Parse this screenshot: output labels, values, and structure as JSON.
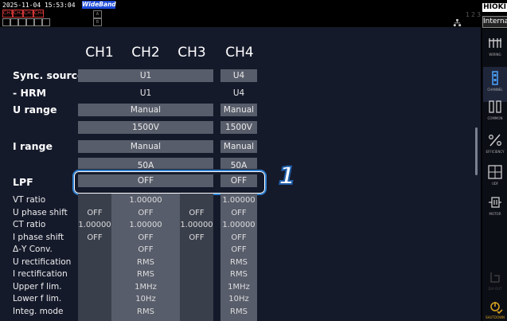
{
  "status": {
    "datetime": "2025-11-04 15:53:04",
    "bandwidth": "WideBand",
    "ch_badges": [
      "CH1",
      "CH2",
      "CH3",
      "CH4"
    ],
    "mid_badges": [
      "A",
      "B"
    ],
    "right_counters": [
      "1",
      "2",
      "3",
      "4"
    ]
  },
  "header": {
    "brand": "HIOKI",
    "mode": "Internal"
  },
  "columns": [
    "CH1",
    "CH2",
    "CH3",
    "CH4"
  ],
  "rows": {
    "sync_source": {
      "label": "Sync. source",
      "ch123": "U1",
      "ch4": "U4"
    },
    "hrm": {
      "label": "- HRM",
      "ch123": "U1",
      "ch4": "U4"
    },
    "u_range": {
      "label": "U range",
      "ch123": "Manual",
      "ch4": "Manual",
      "value_ch123": "1500V",
      "value_ch4": "1500V"
    },
    "i_range": {
      "label": "I range",
      "ch123": "Manual",
      "ch4": "Manual",
      "value_ch123": "50A",
      "value_ch4": "50A"
    },
    "lpf": {
      "label": "LPF",
      "ch123": "OFF",
      "ch4": "OFF"
    }
  },
  "detail_rows": [
    {
      "label": "VT ratio",
      "ch1": "",
      "ch2": "1.00000",
      "ch3": "",
      "ch4": "1.00000"
    },
    {
      "label": "U phase shift",
      "ch1": "OFF",
      "ch2": "OFF",
      "ch3": "OFF",
      "ch4": "OFF"
    },
    {
      "label": "CT ratio",
      "ch1": "1.00000",
      "ch2": "1.00000",
      "ch3": "1.00000",
      "ch4": "1.00000"
    },
    {
      "label": "I phase shift",
      "ch1": "OFF",
      "ch2": "OFF",
      "ch3": "OFF",
      "ch4": "OFF"
    },
    {
      "label": "Δ-Y Conv.",
      "ch1": "",
      "ch2": "OFF",
      "ch3": "",
      "ch4": "OFF"
    },
    {
      "label": "U rectification",
      "ch1": "",
      "ch2": "RMS",
      "ch3": "",
      "ch4": "RMS"
    },
    {
      "label": "I rectification",
      "ch1": "",
      "ch2": "RMS",
      "ch3": "",
      "ch4": "RMS"
    },
    {
      "label": "Upper f lim.",
      "ch1": "",
      "ch2": "1MHz",
      "ch3": "",
      "ch4": "1MHz"
    },
    {
      "label": "Lower f lim.",
      "ch1": "",
      "ch2": "10Hz",
      "ch3": "",
      "ch4": "10Hz"
    },
    {
      "label": "Integ. mode",
      "ch1": "",
      "ch2": "RMS",
      "ch3": "",
      "ch4": "RMS"
    }
  ],
  "callout": "1",
  "sidebar": [
    {
      "name": "WIRING",
      "icon": "wiring-icon"
    },
    {
      "name": "CHANNEL",
      "icon": "channel-icon"
    },
    {
      "name": "COMMON",
      "icon": "common-icon"
    },
    {
      "name": "EFFICIENCY",
      "icon": "efficiency-icon"
    },
    {
      "name": "UDF",
      "icon": "udf-icon"
    },
    {
      "name": "MOTOR",
      "icon": "motor-icon"
    },
    {
      "name": "D/A OUT",
      "icon": "da-out-icon"
    },
    {
      "name": "SHUTDOWN",
      "icon": "shutdown-icon"
    }
  ],
  "colors": {
    "panel": "#151a2b",
    "cell": "#585d6b",
    "highlight": "#2f80d0",
    "accent": "#1e4bd8"
  }
}
